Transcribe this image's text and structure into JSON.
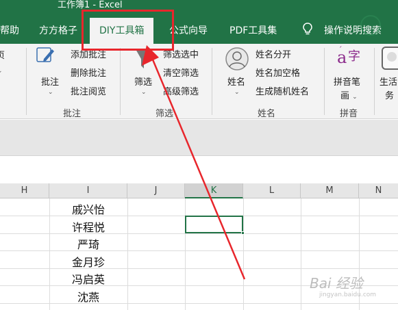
{
  "window": {
    "title": "工作簿1  -  Excel"
  },
  "tabs": [
    {
      "label": "帮助"
    },
    {
      "label": "方方格子"
    },
    {
      "label": "DIY工具箱"
    },
    {
      "label": "公式向导"
    },
    {
      "label": "PDF工具集"
    },
    {
      "label": "操作说明搜索"
    }
  ],
  "ribbon": {
    "left_fragments": [
      "页",
      "",
      ""
    ],
    "annotation_group": {
      "big_button": "批注",
      "items": [
        "添加批注",
        "删除批注",
        "批注阅览"
      ],
      "group_label": "批注"
    },
    "filter_group": {
      "big_button": "筛选",
      "items": [
        "筛选选中",
        "清空筛选",
        "高级筛选"
      ],
      "group_label": "筛选"
    },
    "name_group": {
      "big_button": "姓名",
      "items": [
        "姓名分开",
        "姓名加空格",
        "生成随机姓名"
      ],
      "group_label": "姓名"
    },
    "pinyin_group": {
      "big_button_line1": "拼音笔",
      "big_button_line2": "画",
      "glyph": "a",
      "group_label": "拼音"
    },
    "life_group": {
      "big_button_line1": "生活",
      "big_button_line2": "务"
    }
  },
  "sheet": {
    "columns": [
      "H",
      "I",
      "J",
      "K",
      "L",
      "M",
      "N"
    ],
    "selected_column": "K",
    "column_i_values": [
      "戚兴怡",
      "许程悦",
      "严琦",
      "金月珍",
      "冯启英",
      "沈燕"
    ]
  },
  "colors": {
    "excel_green": "#217346",
    "highlight_red": "#e8262c"
  },
  "watermark": {
    "text": "Bai 经验",
    "url": "jingyan.baidu.com"
  }
}
